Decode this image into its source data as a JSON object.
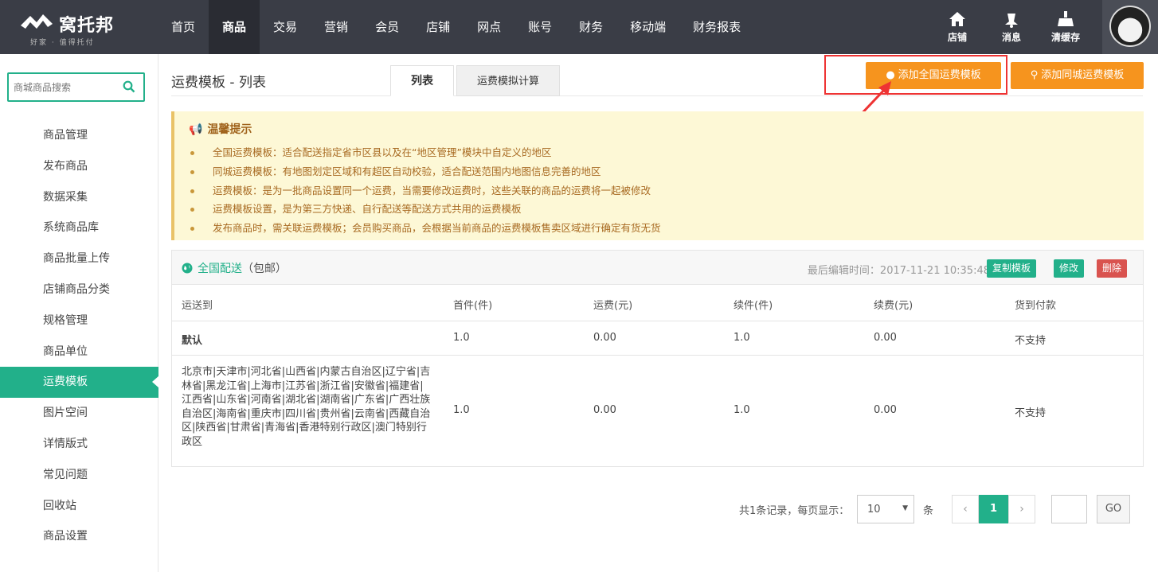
{
  "brand": {
    "name": "窝托邦",
    "slogan": "好家 · 值得托付"
  },
  "nav": [
    "首页",
    "商品",
    "交易",
    "营销",
    "会员",
    "店铺",
    "网点",
    "账号",
    "财务",
    "移动端",
    "财务报表"
  ],
  "top_icons": [
    {
      "label": "店铺",
      "icon": "home-icon"
    },
    {
      "label": "消息",
      "icon": "bell-icon"
    },
    {
      "label": "清缓存",
      "icon": "broom-icon"
    }
  ],
  "sidebar": {
    "search_placeholder": "商城商品搜索",
    "items": [
      "商品管理",
      "发布商品",
      "数据采集",
      "系统商品库",
      "商品批量上传",
      "店铺商品分类",
      "规格管理",
      "商品单位",
      "运费模板",
      "图片空间",
      "详情版式",
      "常见问题",
      "回收站",
      "商品设置"
    ]
  },
  "main": {
    "title": "运费模板 - 列表",
    "tabs": [
      "列表",
      "运费模拟计算"
    ],
    "buttons": {
      "add_national": "添加全国运费模板",
      "add_city": "添加同城运费模板"
    },
    "tips": {
      "title": "温馨提示",
      "items": [
        "全国运费模板：适合配送指定省市区县以及在“地区管理”模块中自定义的地区",
        "同城运费模板：有地图划定区域和有超区自动校验，适合配送范围内地图信息完善的地区",
        "运费模板：是为一批商品设置同一个运费，当需要修改运费时，这些关联的商品的运费将一起被修改",
        "运费模板设置，是为第三方快递、自行配送等配送方式共用的运费模板",
        "发布商品时，需关联运费模板；会员购买商品，会根据当前商品的运费模板售卖区域进行确定有货无货"
      ]
    },
    "template": {
      "name": "全国配送",
      "note": "（包邮）",
      "edit_time": "最后编辑时间：2017-11-21 10:35:48",
      "actions": {
        "copy": "复制模板",
        "edit": "修改",
        "delete": "删除"
      },
      "columns": [
        "运送到",
        "首件(件)",
        "运费(元)",
        "续件(件)",
        "续费(元)",
        "货到付款"
      ],
      "rows": [
        [
          "默认",
          "1.0",
          "0.00",
          "1.0",
          "0.00",
          "不支持"
        ],
        [
          "北京市|天津市|河北省|山西省|内蒙古自治区|辽宁省|吉林省|黑龙江省|上海市|江苏省|浙江省|安徽省|福建省|江西省|山东省|河南省|湖北省|湖南省|广东省|广西壮族自治区|海南省|重庆市|四川省|贵州省|云南省|西藏自治区|陕西省|甘肃省|青海省|香港特别行政区|澳门特别行政区",
          "1.0",
          "0.00",
          "1.0",
          "0.00",
          "不支持"
        ]
      ]
    },
    "pagination": {
      "total_text": "共1条记录，每页显示：",
      "page_size": "10",
      "unit": "条",
      "prev": "‹",
      "current_page": "1",
      "next": "›",
      "go": "GO"
    }
  },
  "colors": {
    "topbar": "#3a3d46",
    "accent": "#22b08a",
    "orange": "#f6941e",
    "danger": "#d9534f",
    "highlight_box": "#ee3333"
  }
}
